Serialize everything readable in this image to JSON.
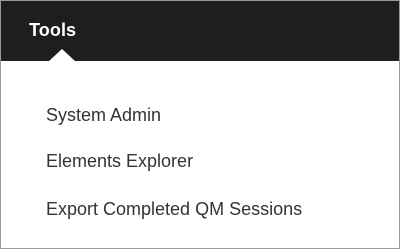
{
  "menu": {
    "title": "Tools",
    "items": [
      {
        "label": "System Admin"
      },
      {
        "label": "Elements Explorer"
      },
      {
        "label": "Export Completed QM Sessions"
      }
    ]
  },
  "colors": {
    "menu_bar_background": "#1e1e1e",
    "menu_title_text": "#ffffff",
    "dropdown_background": "#ffffff",
    "item_text": "#333333"
  }
}
